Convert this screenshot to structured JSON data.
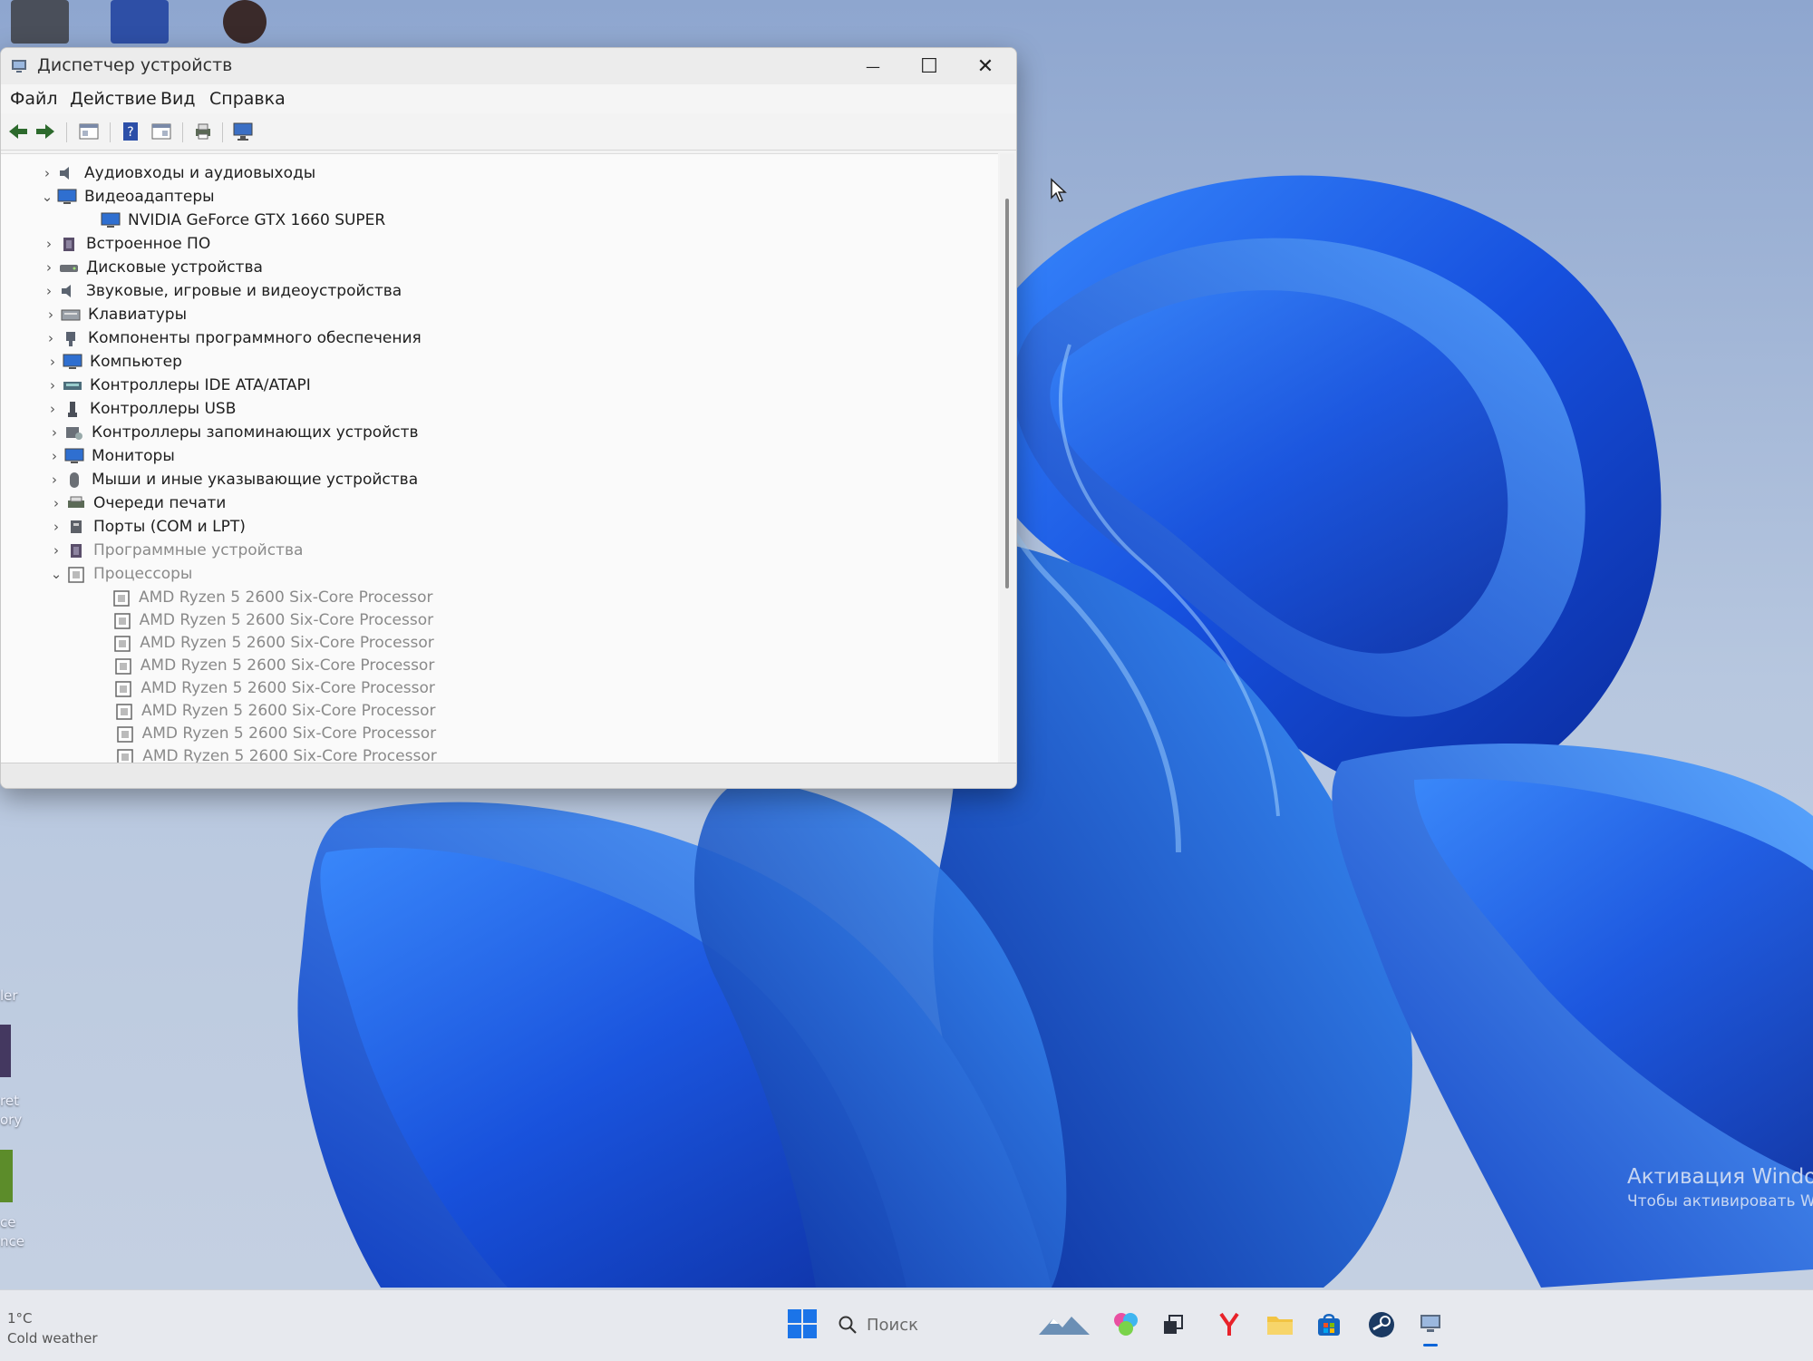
{
  "window": {
    "title": "Диспетчер устройств",
    "minimize_glyph": "—",
    "maximize_glyph": "☐",
    "close_glyph": "✕"
  },
  "menu": {
    "file": "Файл",
    "action": "Действие",
    "view": "Вид",
    "help": "Справка"
  },
  "toolbar": {
    "back": "arrow-left-icon",
    "forward": "arrow-right-icon",
    "properties": "properties-icon",
    "help": "help-icon",
    "console": "console-icon",
    "print": "print-icon",
    "monitor": "monitor-icon"
  },
  "tree": {
    "audio_io": "Аудиовходы и аудиовыходы",
    "video_adapters": "Видеоадаптеры",
    "gpu": "NVIDIA GeForce GTX 1660 SUPER",
    "firmware": "Встроенное ПО",
    "disk_drives": "Дисковые устройства",
    "sound": "Звуковые, игровые и видеоустройства",
    "keyboards": "Клавиатуры",
    "software_components": "Компоненты программного обеспечения",
    "computer": "Компьютер",
    "ide": "Контроллеры IDE ATA/ATAPI",
    "usb": "Контроллеры USB",
    "storage": "Контроллеры запоминающих устройств",
    "monitors": "Мониторы",
    "mice": "Мыши и иные указывающие устройства",
    "print_queues": "Очереди печати",
    "ports": "Порты (COM и LPT)",
    "software_devices": "Программные устройства",
    "processors": "Процессоры",
    "cpu": "AMD Ryzen 5 2600 Six-Core Processor"
  },
  "desktop": {
    "activation_title": "Активация Windo",
    "activation_sub": "Чтобы активировать W",
    "left_labels": [
      "ler",
      "ret",
      "ory",
      "ce",
      "nce"
    ]
  },
  "taskbar": {
    "temperature": "1°C",
    "weather": "Cold weather",
    "search_placeholder": "Поиск"
  },
  "colors": {
    "wallpaper_blue": "#1f5fe0",
    "accent": "#0a64d8"
  }
}
